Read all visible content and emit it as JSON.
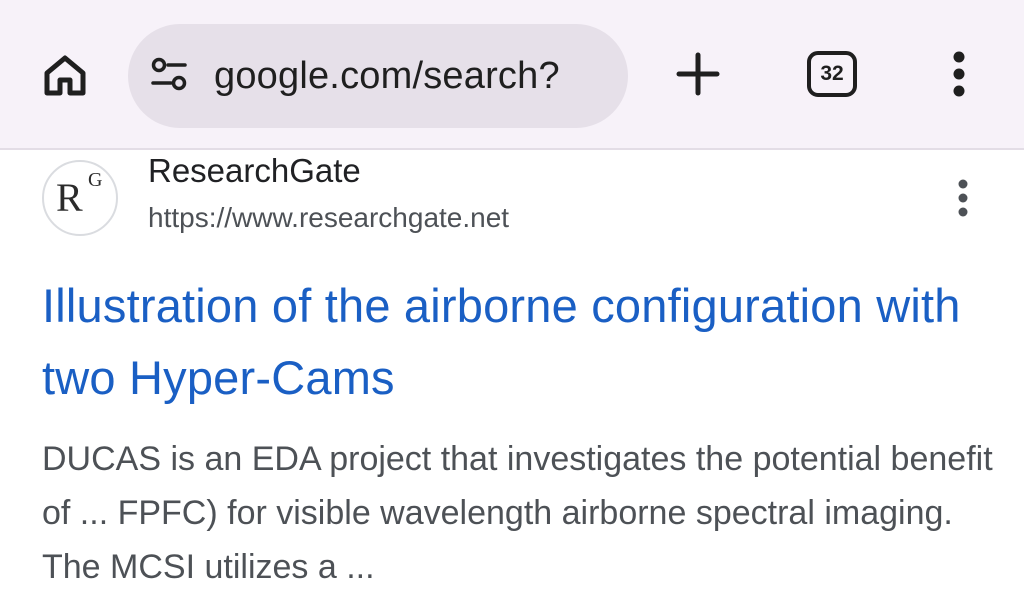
{
  "browser": {
    "url": "google.com/search?",
    "tab_count": "32",
    "icons": {
      "home": "home-icon",
      "site_info": "tune-icon",
      "new_tab": "plus-icon",
      "menu": "more-vert-icon"
    }
  },
  "result": {
    "site_name": "ResearchGate",
    "site_url": "https://www.researchgate.net",
    "favicon_letters": [
      "R",
      "G"
    ],
    "title": "Illustration of the airborne configuration with two Hyper-Cams",
    "snippet": "DUCAS is an EDA project that investigates the potential benefit of ... FPFC) for visible wavelength airborne spectral imaging. The MCSI utilizes a ..."
  },
  "colors": {
    "toolbar_bg": "#f7f2f9",
    "omnibox_bg": "#e6e0e9",
    "link_blue": "#1a5fc4",
    "text_dark": "#202124",
    "text_gray": "#4d5156"
  }
}
